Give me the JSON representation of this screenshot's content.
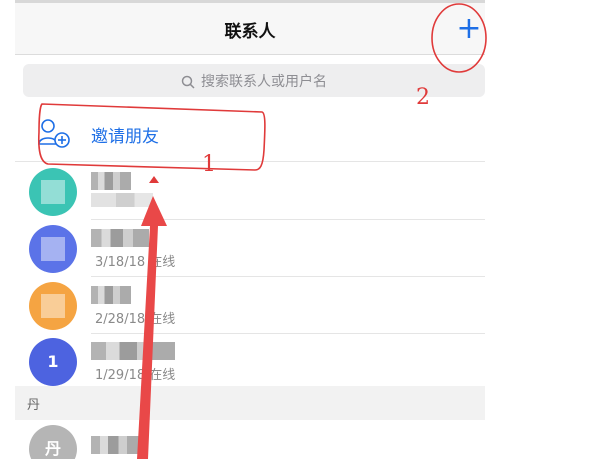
{
  "header": {
    "title": "联系人",
    "add_symbol": "+"
  },
  "search": {
    "placeholder": "搜索联系人或用户名"
  },
  "invite": {
    "label": "邀请朋友"
  },
  "contacts": [
    {
      "avatar_color": "#3bc4b4",
      "avatar_text": "",
      "status": ""
    },
    {
      "avatar_color": "#5b73e8",
      "avatar_text": "",
      "status": "3/18/18 在线"
    },
    {
      "avatar_color": "#f5a442",
      "avatar_text": "",
      "status": "2/28/18 在线"
    },
    {
      "avatar_color": "#4d63e0",
      "avatar_text": "1",
      "status": "1/29/18 在线"
    }
  ],
  "section": {
    "letter": "丹"
  },
  "partial_contact": {
    "avatar_color": "#b5b5b5",
    "avatar_text": "丹"
  },
  "annotations": {
    "label_1": "1",
    "label_2": "2"
  },
  "colors": {
    "accent": "#1e6fe6",
    "annotation": "#e03a3a"
  }
}
